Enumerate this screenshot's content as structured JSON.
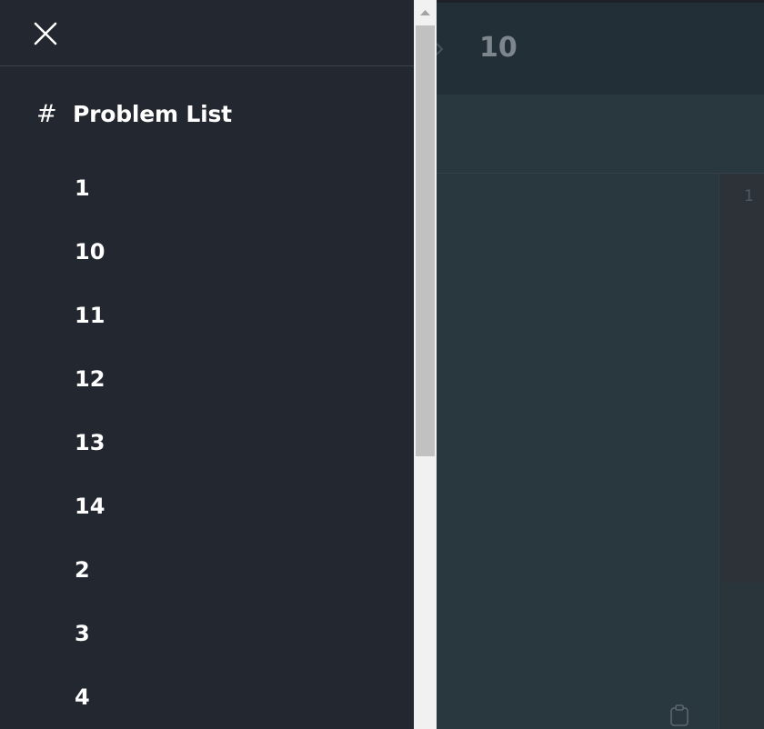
{
  "background": {
    "breadcrumb_current": "10",
    "editor_line_number": "1",
    "icons": {
      "breadcrumb_separator": "chevron-right-icon",
      "copy": "clipboard-icon"
    }
  },
  "drawer": {
    "close_icon": "close-icon",
    "heading": {
      "icon": "hash-icon",
      "hash": "#",
      "title": "Problem List"
    },
    "items": [
      "1",
      "10",
      "11",
      "12",
      "13",
      "14",
      "2",
      "3",
      "4"
    ]
  },
  "scrollbar": {
    "position_fraction": 0.0,
    "visible_fraction": 0.59
  },
  "colors": {
    "drawer_bg": "#23272f",
    "app_bg": "#2a3740",
    "header_bg": "#232f37",
    "text": "#ffffff"
  }
}
